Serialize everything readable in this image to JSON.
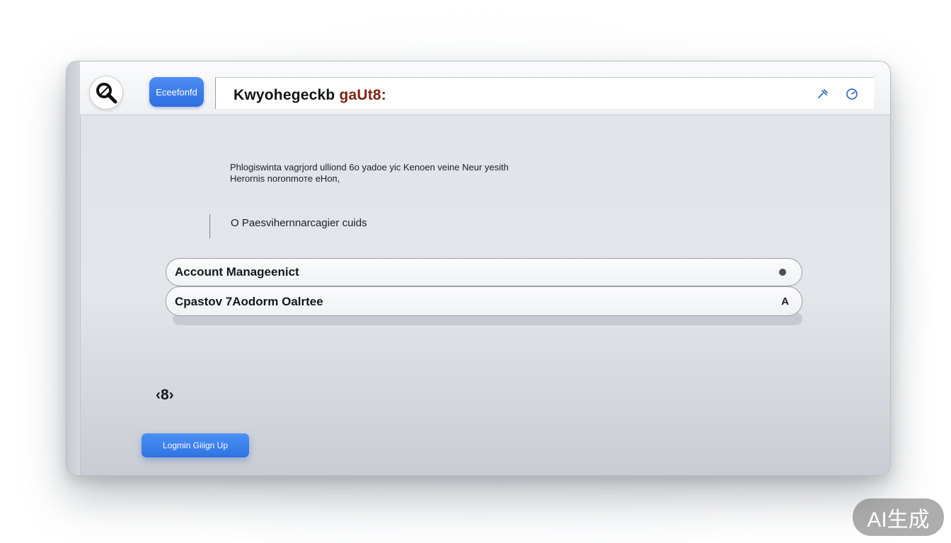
{
  "header": {
    "brand_button": "Eceefonfd",
    "search_text_main": "Kwyohegeckb ",
    "search_text_accent": "gaUt8:"
  },
  "content": {
    "description_line1": "Phlogiswinta vagrjord ulliond 6o yadoe yic Kenoen veine Neur yesith",
    "description_line2": "Herornis noronmoте eНоп,",
    "radio_option": "O Paesvihernnarcagier cuids",
    "rows": [
      {
        "label": "Account Manageenict",
        "icon": "status-dot"
      },
      {
        "label": "Cpastov 7Aodorm Oalrtee",
        "icon": "A"
      }
    ],
    "mini_text": "‹8›"
  },
  "footer": {
    "login_button": "Logmin Giiign  Up"
  },
  "watermark": "AI生成",
  "colors": {
    "accent_blue": "#2c6fe0",
    "accent_text": "#7a2414"
  }
}
